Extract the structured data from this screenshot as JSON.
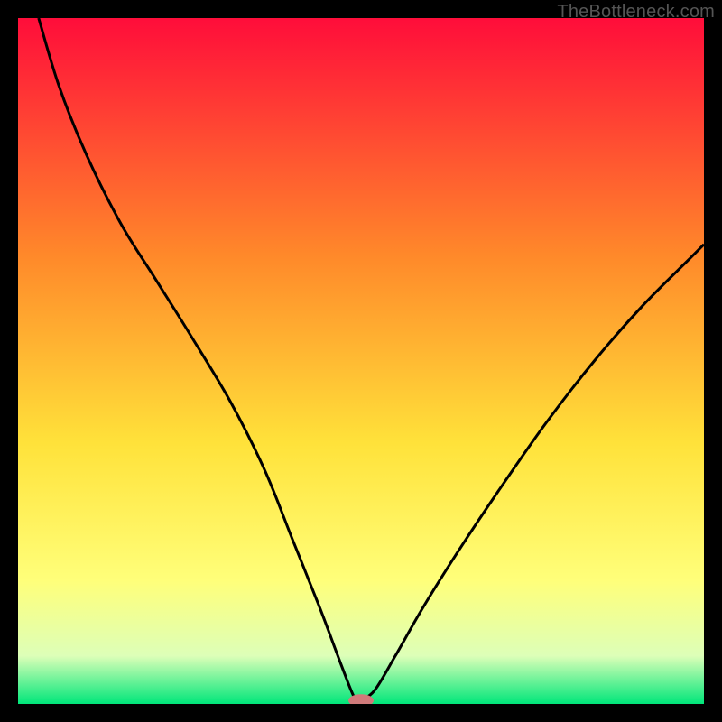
{
  "watermark": "TheBottleneck.com",
  "colors": {
    "gradient_top": "#ff0d3a",
    "gradient_mid1": "#ff8a2a",
    "gradient_mid2": "#ffe23a",
    "gradient_mid3": "#ffff7a",
    "gradient_mid4": "#ddffb8",
    "gradient_bottom": "#00e67a",
    "curve": "#000000",
    "marker": "#d07a7a",
    "bg": "#000000"
  },
  "chart_data": {
    "type": "line",
    "title": "",
    "xlabel": "",
    "ylabel": "",
    "xlim": [
      0,
      100
    ],
    "ylim": [
      0,
      100
    ],
    "marker": {
      "x": 50,
      "y": 0.5
    },
    "series": [
      {
        "name": "curve-left",
        "x": [
          3,
          6,
          10,
          15,
          20,
          25,
          31,
          36,
          40,
          44,
          47,
          49,
          50
        ],
        "y": [
          100,
          90,
          80,
          70,
          62,
          54,
          44,
          34,
          24,
          14,
          6,
          1,
          0.5
        ]
      },
      {
        "name": "curve-right",
        "x": [
          50,
          52,
          55,
          59,
          64,
          70,
          77,
          84,
          91,
          98,
          100
        ],
        "y": [
          0.5,
          2,
          7,
          14,
          22,
          31,
          41,
          50,
          58,
          65,
          67
        ]
      }
    ]
  }
}
